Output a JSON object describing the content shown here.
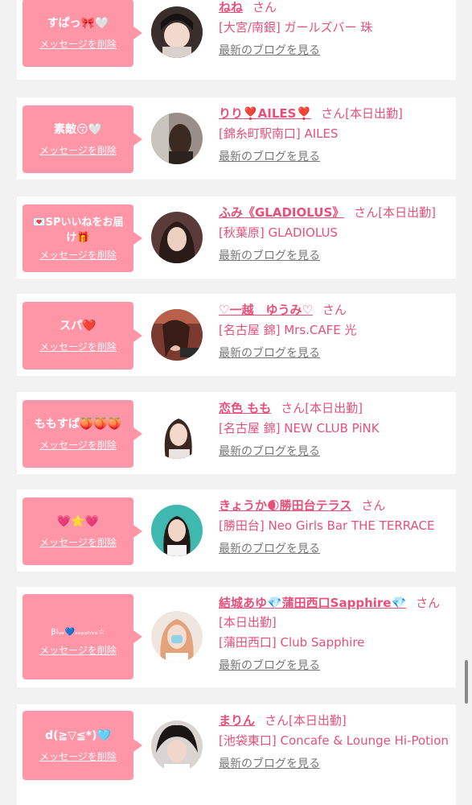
{
  "delete_label": "メッセージを削除",
  "blog_label": "最新のブログを見る",
  "san": "さん",
  "accent_color": "#ff96a8",
  "name_color": "#e8507a",
  "items": [
    {
      "message": "すぱっ🎀🤍",
      "name": "ねね",
      "status": "",
      "shop": "[大宮/南銀] ガールズバー 珠"
    },
    {
      "message": "素敵😚🤍",
      "name": "りり❣️AILES❣️",
      "status": "[本日出勤]",
      "shop": "[錦糸町駅南口] AILES"
    },
    {
      "message": "💌SPいいねをお届け🎁",
      "name": "ふみ《GLADIOLUS》",
      "status": "[本日出勤]",
      "shop": "[秋葉原] GLADIOLUS"
    },
    {
      "message": "スパ❤️",
      "name": "♡一越　ゆうみ♡",
      "status": "",
      "shop": "[名古屋 錦] Mrs.CAFE 光"
    },
    {
      "message": "ももすぱ🍑🍑🍑",
      "name": "恋色 もも",
      "status": "[本日出勤]",
      "shop": "[名古屋 錦] NEW CLUB PiNK"
    },
    {
      "message": "💗⭐️💗",
      "name": "きょうか🌒勝田台テラス",
      "status": "",
      "shop": "[勝田台] Neo Girls Bar THE TERRACE"
    },
    {
      "message": "βlᵤₑ💙ₛₐₚₚₕᵢᵣₑ☆",
      "name": "結城あゆ💎蒲田西口Sapphire💎",
      "status": "[本日出勤]",
      "shop": "[蒲田西口] Club Sapphire"
    },
    {
      "message": "d(≧▽≦*)🩵",
      "name": "まりん",
      "status": "[本日出勤]",
      "shop": "[池袋東口] Concafe & Lounge Hi-Potion"
    }
  ]
}
